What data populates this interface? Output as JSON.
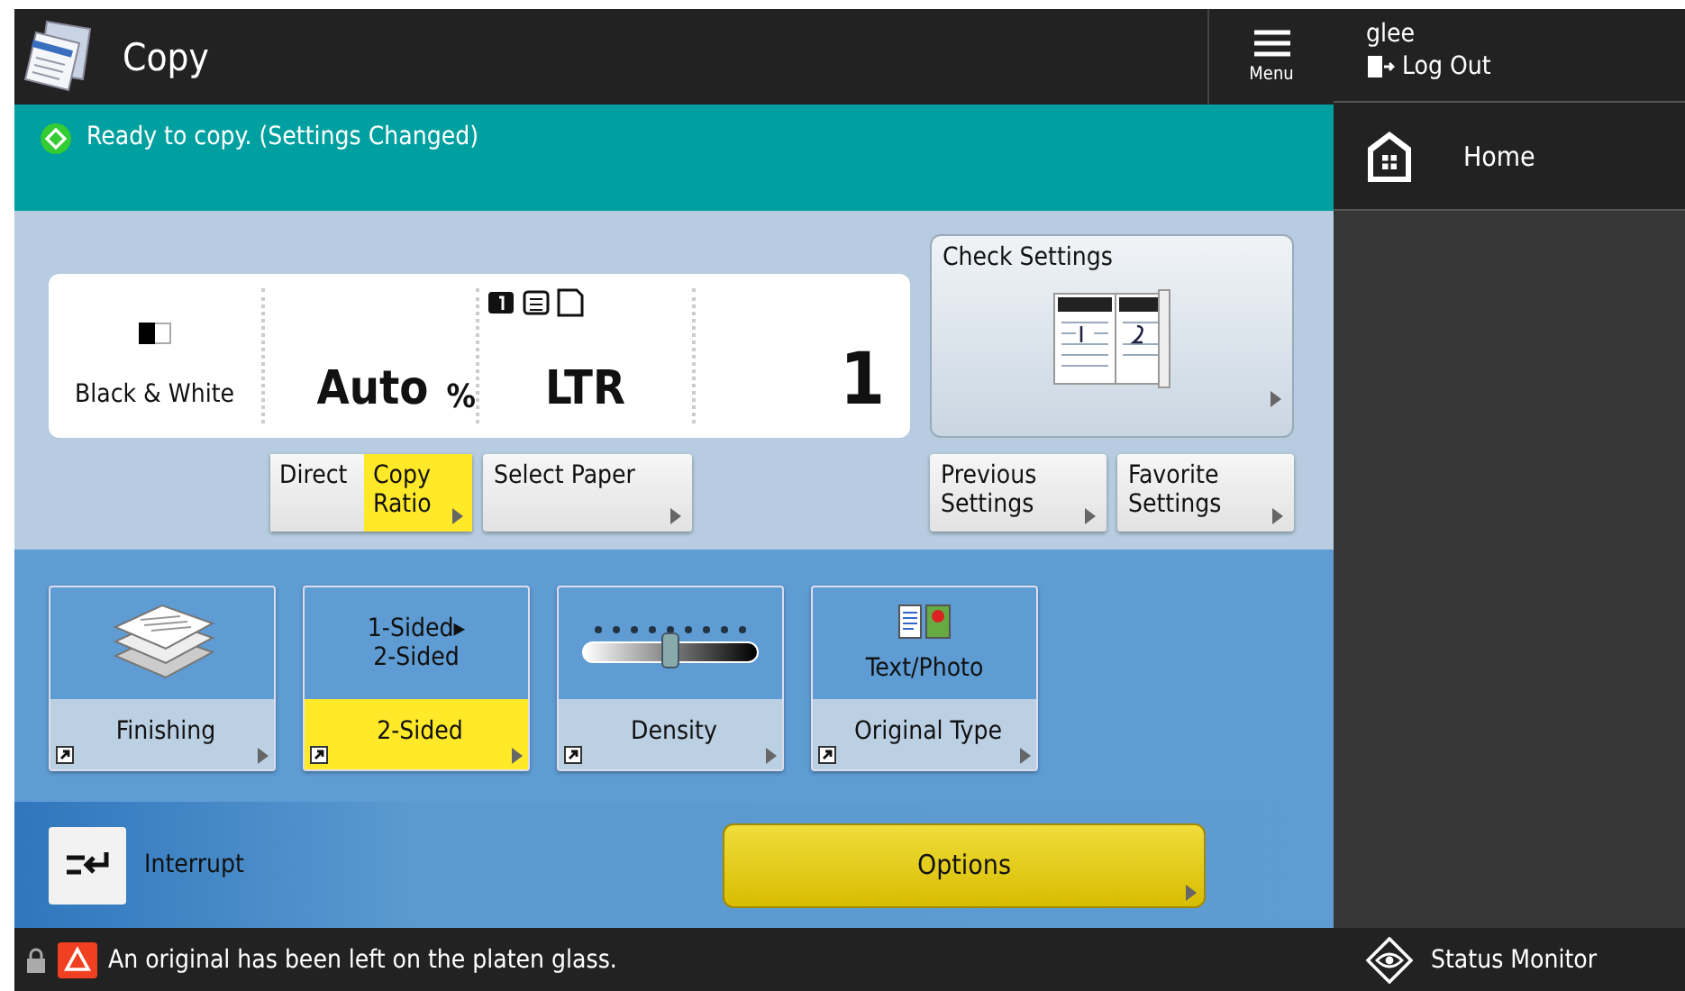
{
  "header": {
    "title": "Copy",
    "menu_label": "Menu"
  },
  "user": {
    "name": "glee",
    "logout": "Log Out"
  },
  "status": "Ready to copy. (Settings Changed)",
  "summary": {
    "color_mode": "Black & White",
    "ratio": "Auto",
    "ratio_unit": "%",
    "paper": "LTR",
    "copies": "1"
  },
  "ratio_buttons": [
    {
      "label": "Direct",
      "selected": false
    },
    {
      "label": "Copy Ratio",
      "selected": true
    }
  ],
  "select_paper": "Select Paper",
  "check_settings": "Check Settings",
  "side_buttons": [
    "Previous Settings",
    "Favorite Settings"
  ],
  "functions": [
    {
      "kind": "finishing",
      "label": "Finishing",
      "selected": false
    },
    {
      "kind": "duplex",
      "top_lines": [
        "1-Sided▸",
        "2-Sided"
      ],
      "label": "2-Sided",
      "selected": true
    },
    {
      "kind": "density",
      "level": 0.5,
      "label": "Density",
      "selected": false
    },
    {
      "kind": "original",
      "top_lines": [
        "Text/Photo"
      ],
      "label": "Original Type",
      "selected": false
    }
  ],
  "interrupt": "Interrupt",
  "options": "Options",
  "message": "An original has been left on the platen glass.",
  "home": "Home",
  "status_monitor": "Status Monitor"
}
